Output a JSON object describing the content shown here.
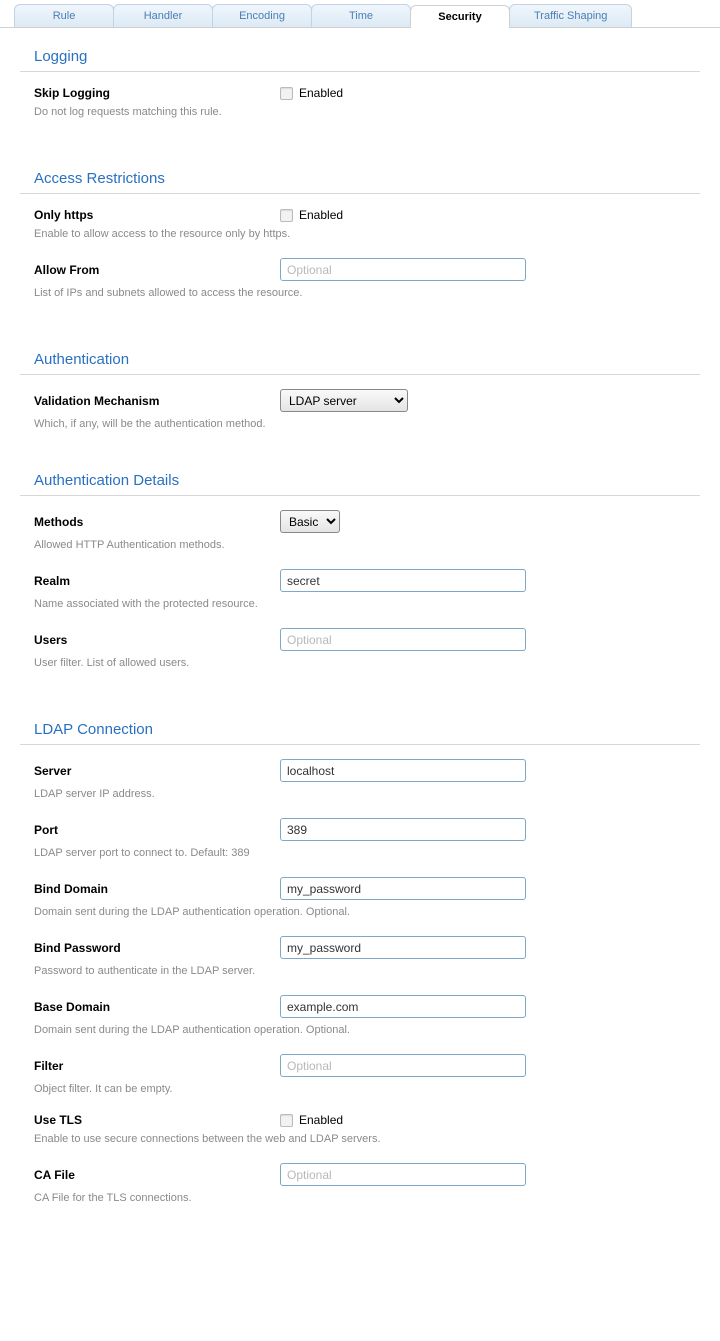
{
  "tabs": {
    "rule": "Rule",
    "handler": "Handler",
    "encoding": "Encoding",
    "time": "Time",
    "security": "Security",
    "traffic_shaping": "Traffic Shaping"
  },
  "enabled_label": "Enabled",
  "optional_placeholder": "Optional",
  "sections": {
    "logging": {
      "title": "Logging",
      "skip_logging": {
        "label": "Skip Logging",
        "desc": "Do not log requests matching this rule."
      }
    },
    "access": {
      "title": "Access Restrictions",
      "only_https": {
        "label": "Only https",
        "desc": "Enable to allow access to the resource only by https."
      },
      "allow_from": {
        "label": "Allow From",
        "desc": "List of IPs and subnets allowed to access the resource."
      }
    },
    "auth": {
      "title": "Authentication",
      "mechanism": {
        "label": "Validation Mechanism",
        "desc": "Which, if any, will be the authentication method.",
        "value": "LDAP server"
      }
    },
    "auth_details": {
      "title": "Authentication Details",
      "methods": {
        "label": "Methods",
        "desc": "Allowed HTTP Authentication methods.",
        "value": "Basic"
      },
      "realm": {
        "label": "Realm",
        "desc": "Name associated with the protected resource.",
        "value": "secret"
      },
      "users": {
        "label": "Users",
        "desc": "User filter. List of allowed users."
      }
    },
    "ldap": {
      "title": "LDAP Connection",
      "server": {
        "label": "Server",
        "desc": "LDAP server IP address.",
        "value": "localhost"
      },
      "port": {
        "label": "Port",
        "desc": "LDAP server port to connect to. Default: 389",
        "value": "389"
      },
      "bind_domain": {
        "label": "Bind Domain",
        "desc": "Domain sent during the LDAP authentication operation. Optional.",
        "value": "my_password"
      },
      "bind_password": {
        "label": "Bind Password",
        "desc": "Password to authenticate in the LDAP server.",
        "value": "my_password"
      },
      "base_domain": {
        "label": "Base Domain",
        "desc": "Domain sent during the LDAP authentication operation. Optional.",
        "value": "example.com"
      },
      "filter": {
        "label": "Filter",
        "desc": "Object filter. It can be empty."
      },
      "use_tls": {
        "label": "Use TLS",
        "desc": "Enable to use secure connections between the web and LDAP servers."
      },
      "ca_file": {
        "label": "CA File",
        "desc": "CA File for the TLS connections."
      }
    }
  }
}
